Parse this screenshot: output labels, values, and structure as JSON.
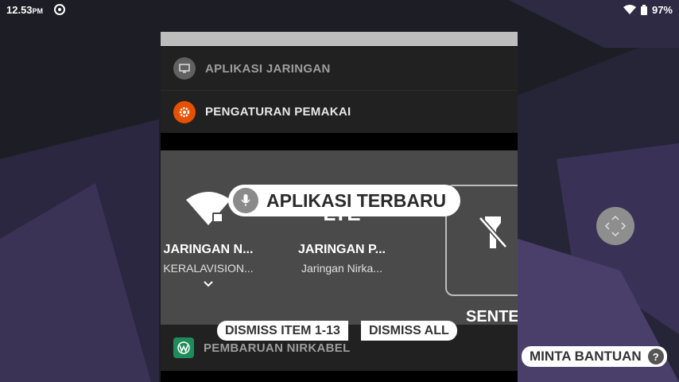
{
  "status_bar": {
    "time": "12.53",
    "ampm": "PM",
    "battery": "97%",
    "icons": [
      "sync-icon",
      "wifi-icon",
      "signal-icon",
      "battery-icon"
    ]
  },
  "recents": {
    "rows": {
      "network": {
        "label": "APLIKASI JARINGAN",
        "icon": "monitor-icon"
      },
      "user": {
        "label": "PENGATURAN PEMAKAI",
        "icon": "gear-icon"
      },
      "wireless": {
        "label": "PEMBARUAN NIRKABEL",
        "icon": "wireless-update-icon"
      }
    },
    "tiles": {
      "wifi": {
        "title": "JARINGAN N...",
        "subtitle": "KERALAVISION..."
      },
      "mobile": {
        "badge": "LTE",
        "title": "JARINGAN P...",
        "subtitle": "Jaringan Nirka..."
      },
      "flashlight": {
        "title": "SENTER"
      }
    }
  },
  "overlay": {
    "recent_apps_label": "APLIKASI TERBARU",
    "dismiss_item_label": "DISMISS ITEM 1-13",
    "dismiss_all_label": "DISMISS ALL",
    "help_label": "MINTA BANTUAN",
    "help_symbol": "?"
  },
  "colors": {
    "accent_orange": "#e65100",
    "tile_background": "#4a4a4a",
    "row_background": "#212121"
  }
}
